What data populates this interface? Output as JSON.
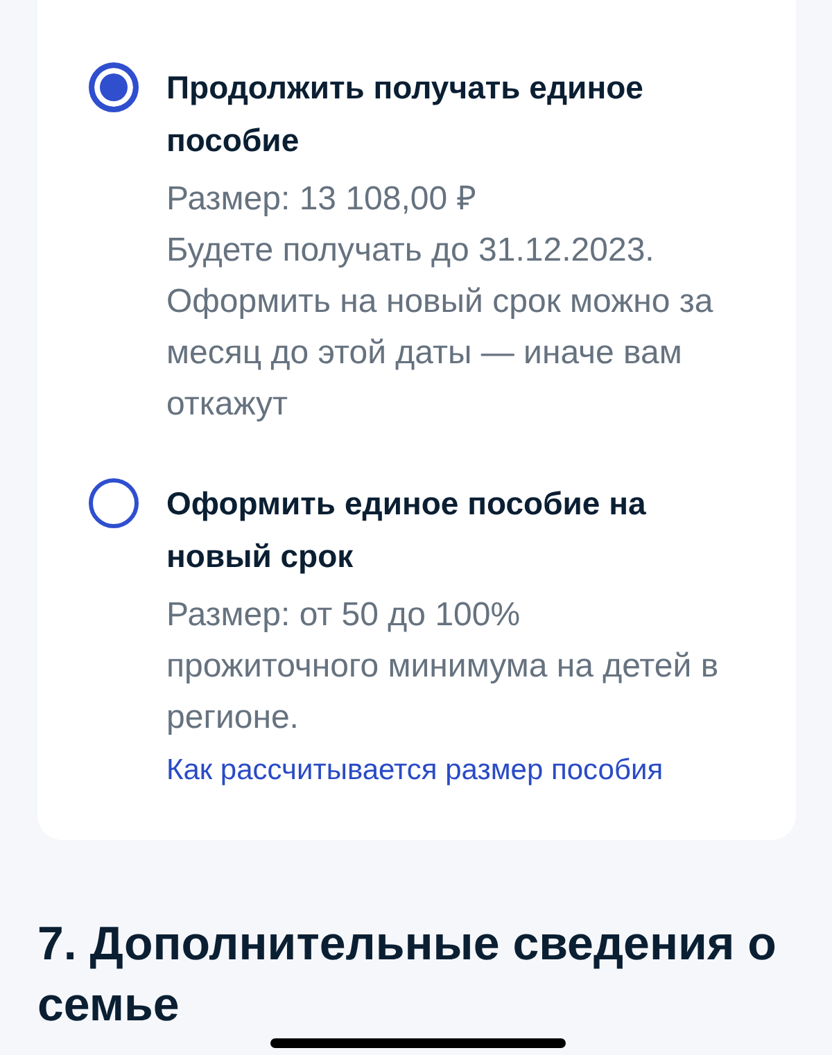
{
  "options": [
    {
      "title": "Продолжить получать единое пособие",
      "selected": true,
      "size": "Размер: 13 108,00 ₽",
      "note": "Будете получать до 31.12.2023. Оформить на новый срок можно за месяц до этой даты — иначе вам откажут"
    },
    {
      "title": "Оформить единое пособие на новый срок",
      "selected": false,
      "size": "Размер: от 50 до 100%",
      "note": "прожиточного минимума на детей в регионе.",
      "link": "Как рассчитывается размер пособия"
    }
  ],
  "section": {
    "title": "7. Дополнительные сведения о семье"
  }
}
